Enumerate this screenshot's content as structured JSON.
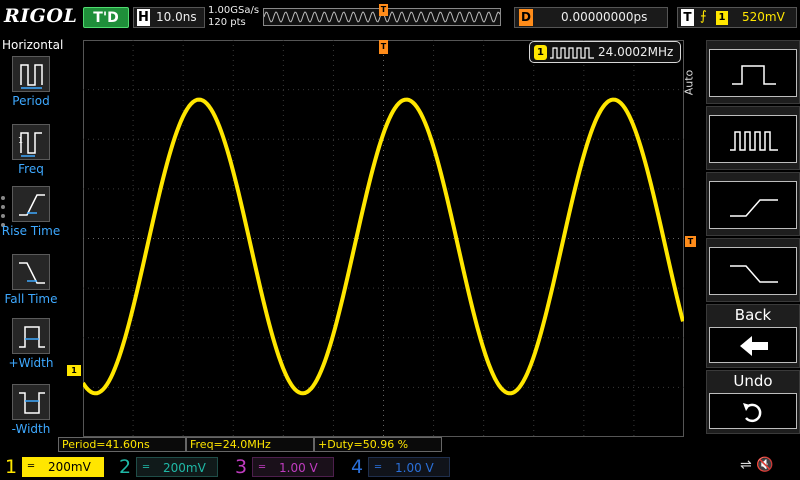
{
  "brand": "RIGOL",
  "topbar": {
    "trigger_status": "T'D",
    "horizontal_label": "H",
    "timebase": "10.0ns",
    "sample_rate": "1.00GSa/s",
    "points": "120 pts",
    "trigger_pos_marker": "T",
    "delay_label": "D",
    "delay_value": "0.00000000ps",
    "trigger_label": "T",
    "trigger_source": "1",
    "trigger_level": "520mV"
  },
  "left_menu": {
    "title": "Horizontal",
    "items": [
      {
        "label": "Period",
        "icon": "period-icon"
      },
      {
        "label": "Freq",
        "icon": "frequency-icon"
      },
      {
        "label": "Rise Time",
        "icon": "rise-time-icon"
      },
      {
        "label": "Fall Time",
        "icon": "fall-time-icon"
      },
      {
        "label": "+Width",
        "icon": "positive-width-icon"
      },
      {
        "label": "-Width",
        "icon": "negative-width-icon"
      }
    ]
  },
  "screen": {
    "trigger_marker": "T",
    "trigger_level_marker": "T",
    "channel_marker": "1",
    "freq_badge": {
      "channel": "1",
      "value": "24.0002MHz"
    },
    "waveform": {
      "channel": "1",
      "shape": "sine",
      "cycles_visible": 2.9,
      "color": "#ffe600"
    }
  },
  "measurements": [
    {
      "text": "Period=41.60ns"
    },
    {
      "text": "Freq=24.0MHz"
    },
    {
      "text": "+Duty=50.96 %"
    }
  ],
  "right_menu": {
    "auto_label": "Auto",
    "keys": [
      {
        "icon": "single-pulse-icon"
      },
      {
        "icon": "pulse-train-icon"
      },
      {
        "icon": "rising-edge-icon"
      },
      {
        "icon": "falling-edge-icon"
      },
      {
        "title": "Back",
        "icon": "back-arrow-icon"
      },
      {
        "title": "Undo",
        "icon": "undo-icon"
      }
    ]
  },
  "channels": [
    {
      "num": "1",
      "coupling": "═",
      "scale": "200mV",
      "color": "#ffe600",
      "active": true
    },
    {
      "num": "2",
      "coupling": "═",
      "scale": "200mV",
      "color": "#1fb8a6",
      "active": false
    },
    {
      "num": "3",
      "coupling": "═",
      "scale": "1.00 V",
      "color": "#c03cc0",
      "active": false
    },
    {
      "num": "4",
      "coupling": "═",
      "scale": "1.00 V",
      "color": "#2a6fd8",
      "active": false
    }
  ],
  "colors": {
    "ch1": "#ffe600",
    "trigger": "#ff8c1a",
    "menu_label": "#3ea9ff",
    "trig_status": "#1f8f3a"
  }
}
